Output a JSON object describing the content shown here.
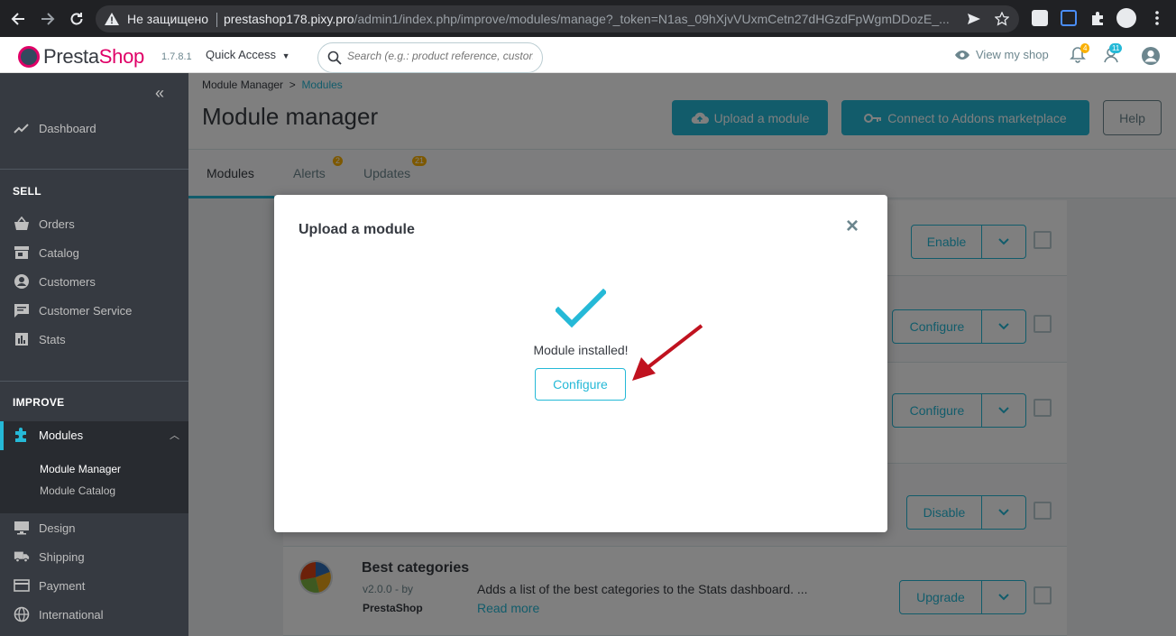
{
  "browser": {
    "insecure_label": "Не защищено",
    "url_host": "prestashop178.pixy.pro",
    "url_path": "/admin1/index.php/improve/modules/manage?_token=N1as_09hXjvVUxmCetn27dHGzdFpWgmDDozE_..."
  },
  "header": {
    "brand_presta": "Presta",
    "brand_shop": "Shop",
    "version": "1.7.8.1",
    "quick_access": "Quick Access",
    "search_placeholder": "Search (e.g.: product reference, custon",
    "view_shop": "View my shop",
    "notif_orders_count": "4",
    "notif_customers_count": "11"
  },
  "sidebar": {
    "dashboard": "Dashboard",
    "sell_title": "SELL",
    "sell_items": [
      "Orders",
      "Catalog",
      "Customers",
      "Customer Service",
      "Stats"
    ],
    "improve_title": "IMPROVE",
    "modules": "Modules",
    "module_manager": "Module Manager",
    "module_catalog": "Module Catalog",
    "improve_items": [
      "Design",
      "Shipping",
      "Payment",
      "International"
    ]
  },
  "page": {
    "breadcrumb_parent": "Module Manager",
    "breadcrumb_current": "Modules",
    "title": "Module manager",
    "upload_btn": "Upload a module",
    "connect_btn": "Connect to Addons marketplace",
    "help_btn": "Help"
  },
  "tabs": {
    "modules": "Modules",
    "alerts": "Alerts",
    "alerts_badge": "2",
    "updates": "Updates",
    "updates_badge": "21"
  },
  "modules_list": {
    "row_actions": [
      "Enable",
      "Configure",
      "Configure",
      "Disable",
      "Upgrade"
    ],
    "last_module": {
      "name": "Best categories",
      "version": "v2.0.0 - by",
      "author": "PrestaShop",
      "description": "Adds a list of the best categories to the Stats dashboard. ...",
      "read_more": "Read more"
    }
  },
  "modal": {
    "title": "Upload a module",
    "close": "×",
    "message": "Module installed!",
    "configure_btn": "Configure"
  },
  "colors": {
    "accent": "#25b9d7",
    "brand_pink": "#df0067",
    "sidebar_bg": "#363a41",
    "annotation_arrow": "#c0121f"
  }
}
